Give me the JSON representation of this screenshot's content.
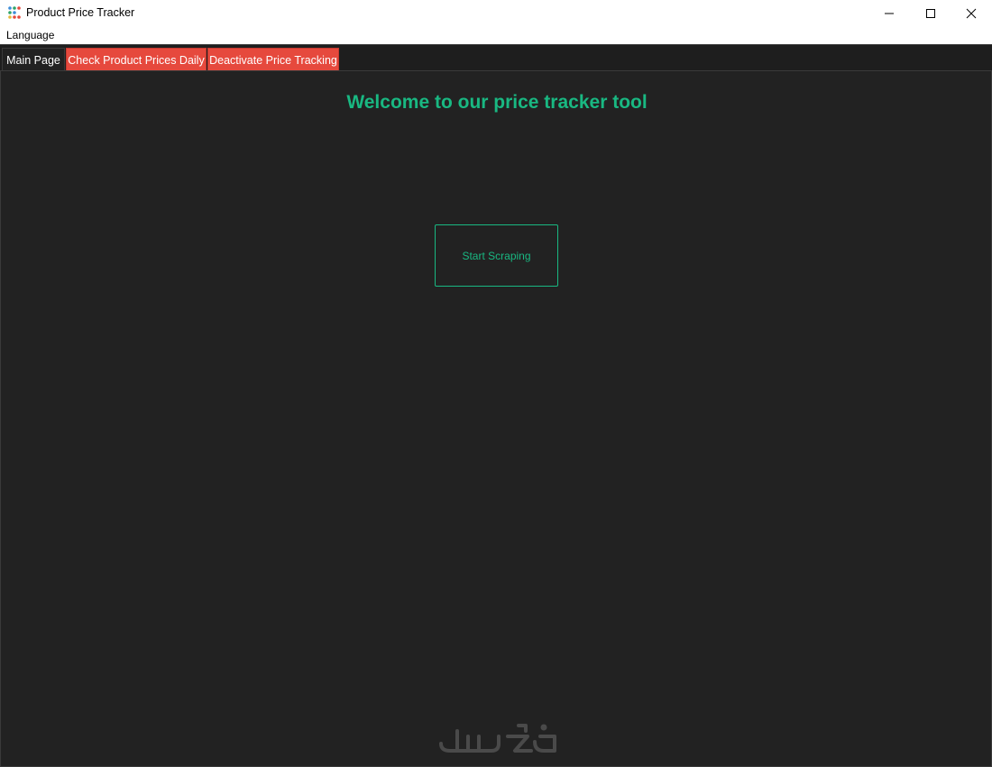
{
  "window": {
    "title": "Product Price Tracker"
  },
  "menu": {
    "items": [
      {
        "label": "Language"
      }
    ]
  },
  "tabs": [
    {
      "label": "Main Page",
      "active": true
    },
    {
      "label": "Check Product Prices Daily",
      "active": false
    },
    {
      "label": "Deactivate Price Tracking",
      "active": false
    }
  ],
  "main": {
    "heading": "Welcome to our price tracker tool",
    "start_button_label": "Start Scraping"
  },
  "icons": {
    "app": "app-dots-icon",
    "minimize": "minimize-icon",
    "maximize": "maximize-icon",
    "close": "close-icon"
  },
  "colors": {
    "accent": "#19b882",
    "tab_inactive": "#e6493d",
    "background": "#222222"
  }
}
